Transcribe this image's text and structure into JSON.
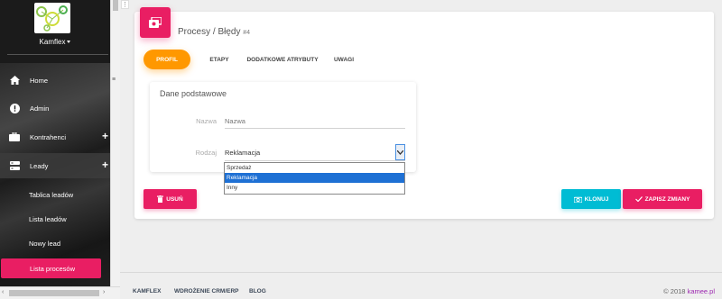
{
  "sidebar": {
    "user_name": "Kamflex",
    "nav": [
      {
        "label": "Home",
        "icon": "home-icon"
      },
      {
        "label": "Admin",
        "icon": "info-icon"
      },
      {
        "label": "Kontrahenci",
        "icon": "briefcase-icon",
        "expandable": true
      },
      {
        "label": "Leady",
        "icon": "leads-icon",
        "expandable": true
      }
    ],
    "sub_items": [
      {
        "label": "Tablica leadów"
      },
      {
        "label": "Lista leadów"
      },
      {
        "label": "Nowy lead"
      },
      {
        "label": "Lista procesów",
        "active": true
      }
    ]
  },
  "header": {
    "title": "Procesy / Błędy",
    "record_number": "#4"
  },
  "tabs": [
    {
      "label": "PROFIL",
      "active": true
    },
    {
      "label": "ETAPY"
    },
    {
      "label": "DODATKOWE ATRYBUTY"
    },
    {
      "label": "UWAGI"
    }
  ],
  "form": {
    "section_title": "Dane podstawowe",
    "name_label": "Nazwa",
    "name_placeholder": "Nazwa",
    "type_label": "Rodzaj",
    "type_value": "Reklamacja",
    "type_options": [
      "Sprzedaż",
      "Reklamacja",
      "Inny"
    ],
    "type_options_selected": "Reklamacja"
  },
  "actions": {
    "delete_label": "USUŃ",
    "clone_label": "KLONUJ",
    "save_label": "ZAPISZ ZMIANY"
  },
  "footer": {
    "links": [
      "KAMFLEX",
      "WDROŻENIE CRM/ERP",
      "BLOG"
    ],
    "copyright_prefix": "© 2018",
    "copyright_brand": "kamee.pl"
  },
  "colors": {
    "primary": "#e91e63",
    "tab_active": "#ff9800",
    "clone": "#00bcd4",
    "sidebar_bg": "#1b1b1b"
  }
}
